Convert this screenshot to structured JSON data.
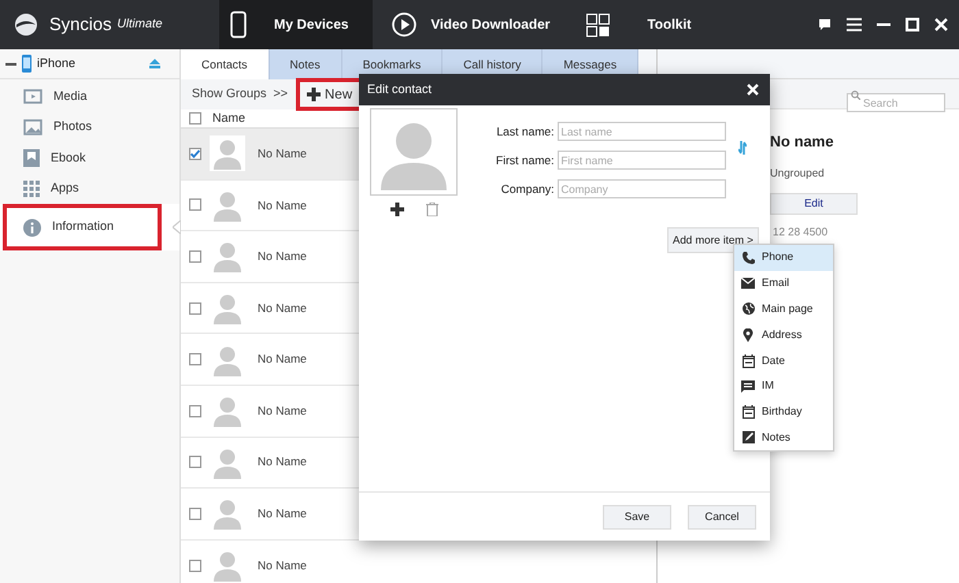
{
  "app": {
    "name": "Syncios",
    "edition": "Ultimate"
  },
  "top_tabs": [
    {
      "label": "My Devices",
      "selected": true,
      "kind": "phone"
    },
    {
      "label": "Video Downloader",
      "selected": false,
      "kind": "play"
    },
    {
      "label": "Toolkit",
      "selected": false,
      "kind": "grid"
    }
  ],
  "device": {
    "name": "iPhone"
  },
  "sidebar": {
    "items": [
      {
        "label": "Media",
        "kind": "media",
        "selected": false,
        "highlighted": false
      },
      {
        "label": "Photos",
        "kind": "photos",
        "selected": false,
        "highlighted": false
      },
      {
        "label": "Ebook",
        "kind": "ebook",
        "selected": false,
        "highlighted": false
      },
      {
        "label": "Apps",
        "kind": "apps",
        "selected": false,
        "highlighted": false
      },
      {
        "label": "Information",
        "kind": "info",
        "selected": true,
        "highlighted": true
      }
    ]
  },
  "info_tabs": [
    {
      "label": "Contacts",
      "selected": true
    },
    {
      "label": "Notes",
      "selected": false
    },
    {
      "label": "Bookmarks",
      "selected": false
    },
    {
      "label": "Call history",
      "selected": false
    },
    {
      "label": "Messages",
      "selected": false
    }
  ],
  "toolbar": {
    "show_groups": "Show Groups  >>",
    "new_button": "New",
    "new_highlighted": true
  },
  "contacts": {
    "header": "Name",
    "select_all_checked": false,
    "rows": [
      {
        "name": "No Name",
        "checked": true
      },
      {
        "name": "No Name",
        "checked": false
      },
      {
        "name": "No Name",
        "checked": false
      },
      {
        "name": "No Name",
        "checked": false
      },
      {
        "name": "No Name",
        "checked": false
      },
      {
        "name": "No Name",
        "checked": false
      },
      {
        "name": "No Name",
        "checked": false
      },
      {
        "name": "No Name",
        "checked": false
      },
      {
        "name": "No Name",
        "checked": false
      }
    ]
  },
  "search": {
    "placeholder": "Search"
  },
  "detail": {
    "name": "No name",
    "group": "Ungrouped",
    "edit_button": "Edit",
    "partial_text": "12 28 4500"
  },
  "dialog": {
    "title": "Edit contact",
    "fields": [
      {
        "label": "Last name:",
        "placeholder": "Last name"
      },
      {
        "label": "First name:",
        "placeholder": "First name"
      },
      {
        "label": "Company:",
        "placeholder": "Company"
      }
    ],
    "add_more": "Add more item >",
    "menu": [
      {
        "label": "Phone",
        "kind": "phone",
        "selected": true
      },
      {
        "label": "Email",
        "kind": "email",
        "selected": false
      },
      {
        "label": "Main page",
        "kind": "globe",
        "selected": false
      },
      {
        "label": "Address",
        "kind": "pin",
        "selected": false
      },
      {
        "label": "Date",
        "kind": "calendar",
        "selected": false
      },
      {
        "label": "IM",
        "kind": "chat",
        "selected": false
      },
      {
        "label": "Birthday",
        "kind": "calendar",
        "selected": false
      },
      {
        "label": "Notes",
        "kind": "note",
        "selected": false
      }
    ],
    "buttons": [
      "Save",
      "Cancel"
    ]
  }
}
